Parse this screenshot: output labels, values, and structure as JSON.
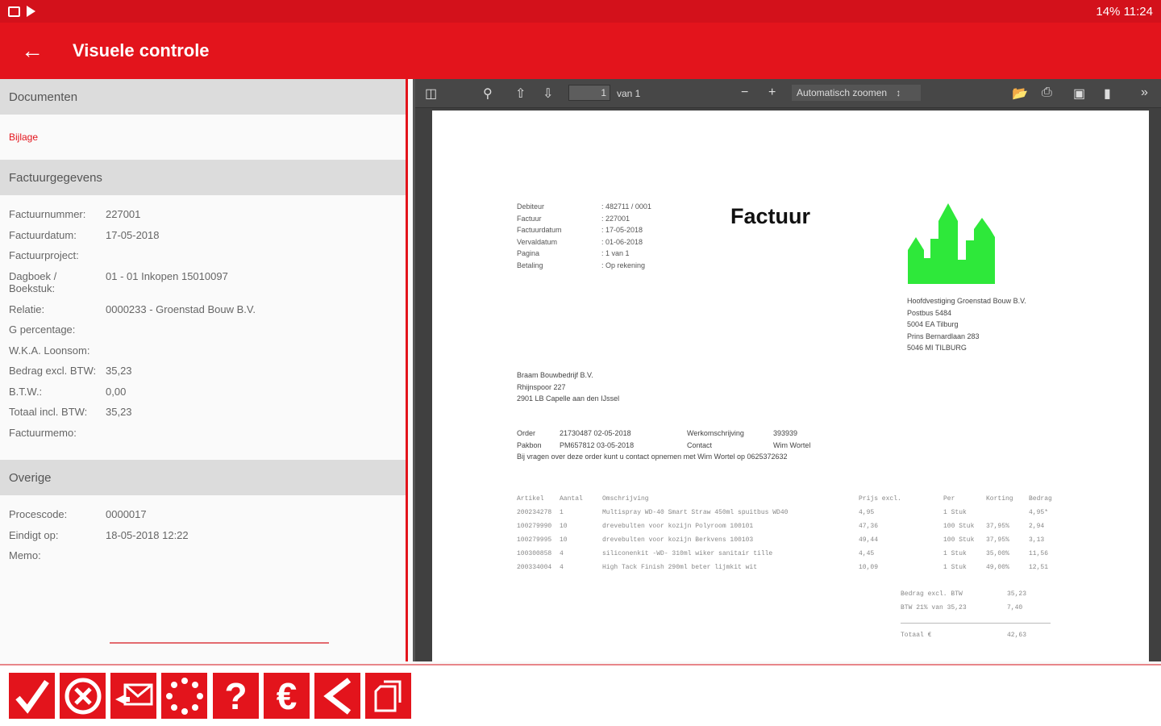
{
  "status_bar": {
    "right": "14% 11:24"
  },
  "app_bar": {
    "title": "Visuele controle"
  },
  "left": {
    "documents_header": "Documenten",
    "attachment_link": "Bijlage",
    "invoice_header": "Factuurgegevens",
    "invoice_fields": [
      {
        "label": "Factuurnummer:",
        "value": "227001"
      },
      {
        "label": "Factuurdatum:",
        "value": "17-05-2018"
      },
      {
        "label": "Factuurproject:",
        "value": ""
      },
      {
        "label": "Dagboek / Boekstuk:",
        "value": "01 - 01 Inkopen  15010097"
      },
      {
        "label": "Relatie:",
        "value": "0000233 - Groenstad Bouw B.V."
      },
      {
        "label": "G percentage:",
        "value": ""
      },
      {
        "label": "W.K.A. Loonsom:",
        "value": ""
      },
      {
        "label": "Bedrag excl. BTW:",
        "value": "35,23"
      },
      {
        "label": "B.T.W.:",
        "value": "0,00"
      },
      {
        "label": "Totaal incl. BTW:",
        "value": "35,23"
      },
      {
        "label": "Factuurmemo:",
        "value": ""
      }
    ],
    "other_header": "Overige",
    "other_fields": [
      {
        "label": "Procescode:",
        "value": "0000017"
      },
      {
        "label": "Eindigt op:",
        "value": "18-05-2018 12:22"
      },
      {
        "label": "Memo:",
        "value": ""
      }
    ]
  },
  "viewer_toolbar": {
    "page_number": "1",
    "page_of": "van 1",
    "zoom": "Automatisch zoomen"
  },
  "invoice_doc": {
    "meta": [
      {
        "k": "Debiteur",
        "v": ": 482711 / 0001"
      },
      {
        "k": "Factuur",
        "v": ": 227001"
      },
      {
        "k": "Factuurdatum",
        "v": ": 17-05-2018"
      },
      {
        "k": "Vervaldatum",
        "v": ": 01-06-2018"
      },
      {
        "k": "Pagina",
        "v": ": 1 van 1"
      },
      {
        "k": "Betaling",
        "v": ": Op rekening"
      }
    ],
    "title": "Factuur",
    "company": [
      "Hoofdvestiging Groenstad Bouw B.V.",
      "Postbus 5484",
      "5004 EA Tilburg",
      "Prins Bernardlaan 283",
      "5046 MI TILBURG"
    ],
    "address": [
      "Braam Bouwbedrijf B.V.",
      "Rhijnspoor 227",
      "2901 LB Capelle aan den IJssel"
    ],
    "order": [
      {
        "a": "Order",
        "b": "21730487 02-05-2018",
        "c": "Werkomschrijving",
        "d": "393939"
      },
      {
        "a": "Pakbon",
        "b": "PM657812 03-05-2018",
        "c": "Contact",
        "d": "Wim Wortel"
      }
    ],
    "note": "Bij vragen over deze order kunt u contact opnemen met Wim Wortel op 0625372632",
    "table_header": [
      "Artikel",
      "Aantal",
      "Omschrijving",
      "Prijs excl.",
      "Per",
      "Korting",
      "Bedrag"
    ],
    "table_rows": [
      [
        "200234278",
        "1",
        "Multispray WD-40 Smart Straw 450ml spuitbus WD40",
        "4,95",
        "1 Stuk",
        "",
        "4,95*"
      ],
      [
        "100279990",
        "10",
        "drevebulten voor kozijn Polyroom 100101",
        "47,36",
        "100 Stuk",
        "37,95%",
        "2,94"
      ],
      [
        "100279995",
        "10",
        "drevebulten voor kozijn Berkvens 100103",
        "49,44",
        "100 Stuk",
        "37,95%",
        "3,13"
      ],
      [
        "100300858",
        "4",
        "siliconenkit -WD- 310ml wiker sanitair tille",
        "4,45",
        "1 Stuk",
        "35,00%",
        "11,56"
      ],
      [
        "200334004",
        "4",
        "High Tack Finish 290ml beter lijmkit wit",
        "10,09",
        "1 Stuk",
        "49,00%",
        "12,51"
      ]
    ],
    "totals": [
      {
        "k": "Bedrag excl. BTW",
        "v": "35,23"
      },
      {
        "k": "BTW 21% van 35,23",
        "v": "7,40"
      }
    ],
    "total": {
      "k": "Totaal €",
      "v": "42,63"
    }
  },
  "bottom_buttons": [
    "approve",
    "reject",
    "mail",
    "progress",
    "help",
    "euro",
    "back",
    "copy"
  ]
}
